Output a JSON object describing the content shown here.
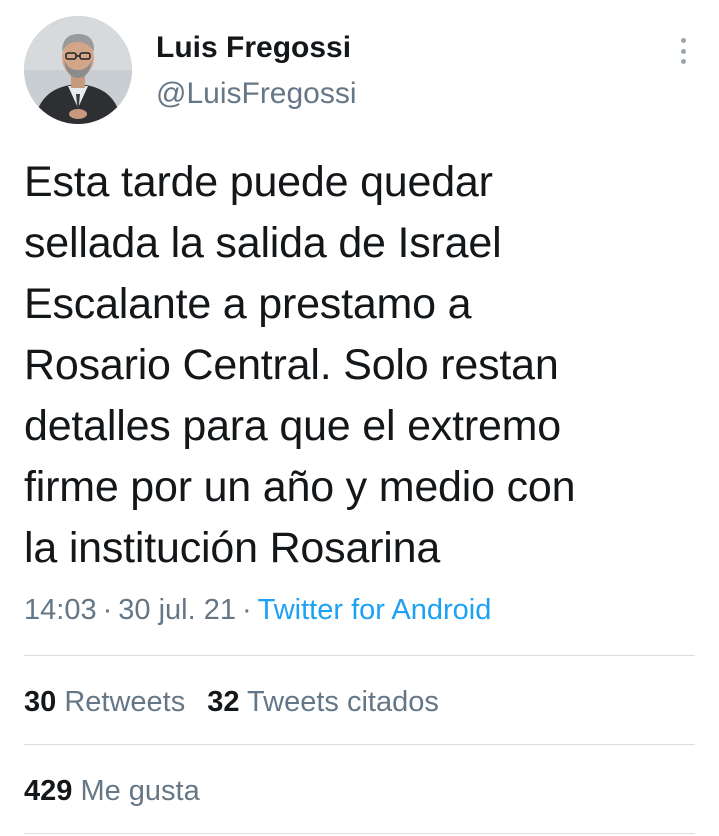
{
  "author": {
    "display_name": "Luis Fregossi",
    "handle": "@LuisFregossi",
    "avatar_icon": "profile-photo"
  },
  "tweet": {
    "lines": [
      "Esta tarde puede quedar",
      "sellada la salida de Israel",
      "Escalante a prestamo a",
      "Rosario Central. Solo restan",
      "detalles para que el extremo",
      "firme por un año y medio con",
      "la institución Rosarina"
    ],
    "time": "14:03",
    "date": "30 jul. 21",
    "separator": "·",
    "source": "Twitter for Android"
  },
  "stats": {
    "retweets_count": "30",
    "retweets_label": "Retweets",
    "quotes_count": "32",
    "quotes_label": "Tweets citados",
    "likes_count": "429",
    "likes_label": "Me gusta"
  },
  "menu_icon": "more-vertical-icon",
  "colors": {
    "text": "#14171a",
    "secondary": "#657786",
    "link": "#1da1f2",
    "divider": "#d9dee2"
  }
}
